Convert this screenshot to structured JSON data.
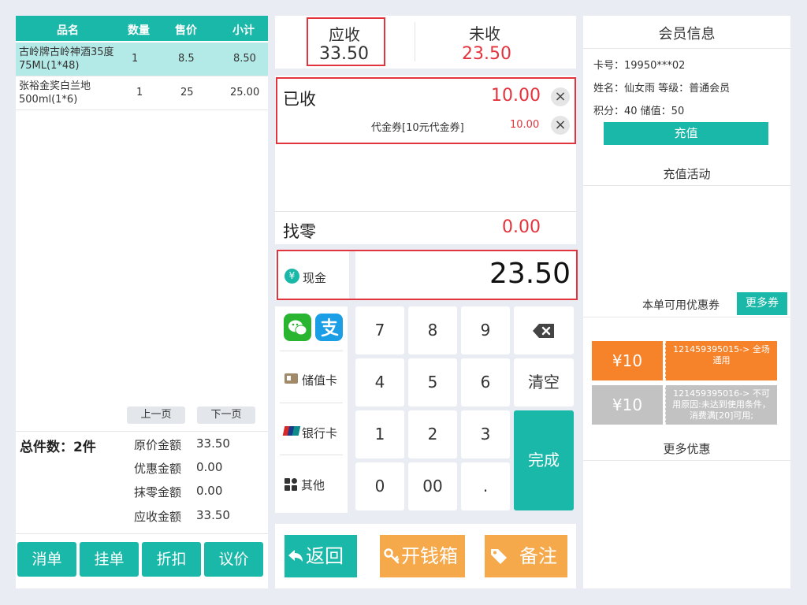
{
  "order": {
    "columns": [
      "品名",
      "数量",
      "售价",
      "小计"
    ],
    "items": [
      {
        "name": "古岭牌古岭神酒35度75ML(1*48)",
        "qty": "1",
        "price": "8.5",
        "subtotal": "8.50"
      },
      {
        "name": "张裕金奖白兰地500ml(1*6)",
        "qty": "1",
        "price": "25",
        "subtotal": "25.00"
      }
    ],
    "prev_page": "上一页",
    "next_page": "下一页",
    "total_count": "总件数：2件",
    "amounts": [
      {
        "label": "原价金额",
        "value": "33.50"
      },
      {
        "label": "优惠金额",
        "value": "0.00"
      },
      {
        "label": "抹零金额",
        "value": "0.00"
      },
      {
        "label": "应收金额",
        "value": "33.50"
      }
    ],
    "actions": [
      "消单",
      "挂单",
      "折扣",
      "议价"
    ]
  },
  "payment": {
    "due_label": "应收",
    "due_value": "33.50",
    "unpaid_label": "未收",
    "unpaid_value": "23.50",
    "received_label": "已收",
    "received_value": "10.00",
    "voucher_label": "代金券[10元代金券]",
    "voucher_value": "10.00",
    "change_label": "找零",
    "change_value": "0.00",
    "method_label": "现金",
    "input_value": "23.50",
    "methods": [
      "储值卡",
      "银行卡",
      "其他"
    ],
    "keys": [
      "7",
      "8",
      "9",
      "4",
      "5",
      "6",
      "清空",
      "1",
      "2",
      "3",
      "0",
      "00",
      ".",
      "完成"
    ],
    "bottom": {
      "back": "返回",
      "cashbox": "开钱箱",
      "note": "备注"
    }
  },
  "member": {
    "title": "会员信息",
    "card": "卡号：19950***02",
    "name_level": "姓名：仙女雨  等级：普通会员",
    "points_balance": "积分：40  储值：50",
    "recharge": "充值",
    "activity_title": "充值活动",
    "coupon_title": "本单可用优惠券",
    "more_coupons": "更多券",
    "coupons": [
      {
        "amount": "¥10",
        "desc": "121459395015-> 全场通用"
      },
      {
        "amount": "¥10",
        "desc": "121459395016-> 不可用原因:未达到使用条件，消费满[20]可用;"
      }
    ],
    "more_offers": "更多优惠"
  },
  "colors": {
    "teal": "#1ab8a8",
    "red": "#e3333c",
    "orange": "#f6822a",
    "amber": "#f5a94a",
    "gray_coupon": "#c2c2c2",
    "highlight_row": "#b3e9e6"
  },
  "icons": [
    "yuan-icon",
    "wechat-pay-icon",
    "alipay-icon",
    "card-icon",
    "unionpay-icon",
    "grid-icon",
    "backspace-icon",
    "back-arrow-icon",
    "key-icon",
    "tag-icon",
    "close-icon"
  ]
}
